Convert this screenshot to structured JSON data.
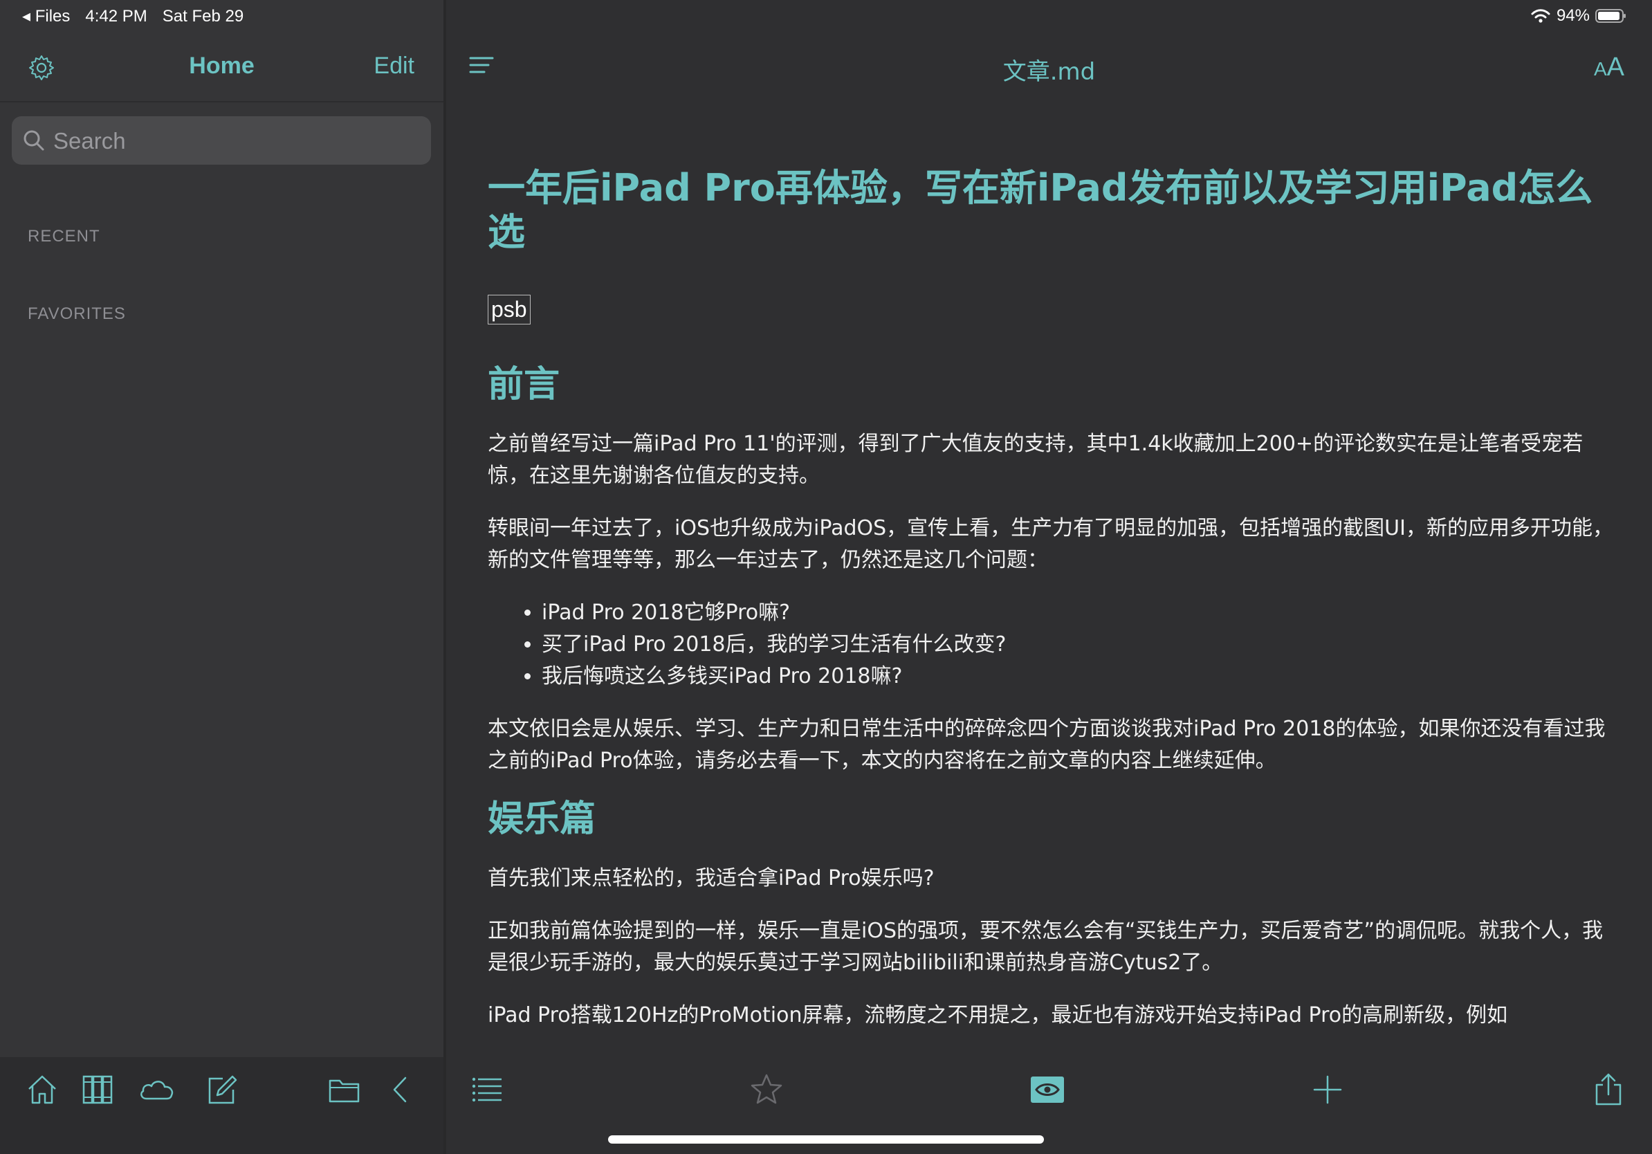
{
  "status_bar": {
    "back_app": "◂ Files",
    "time": "4:42 PM",
    "date": "Sat Feb 29",
    "battery": "94%",
    "battery_level": 0.94,
    "icons": [
      "wifi-icon",
      "battery-icon"
    ]
  },
  "sidebar": {
    "title": "Home",
    "edit_label": "Edit",
    "search_placeholder": "Search",
    "sections": [
      {
        "label": "RECENT"
      },
      {
        "label": "FAVORITES"
      }
    ],
    "toolbar_icons": [
      "home-icon",
      "library-icon",
      "cloud-icon",
      "compose-icon",
      "folder-icon",
      "collapse-chevron-icon"
    ]
  },
  "editor": {
    "doc_title": "文章.md",
    "font_button_small": "A",
    "font_button_big": "A",
    "toolbar_icons": [
      "outline-icon",
      "favorite-star-icon",
      "preview-eye-icon",
      "add-icon",
      "share-icon"
    ]
  },
  "article": {
    "h1": "一年后iPad Pro再体验，写在新iPad发布前以及学习用iPad怎么选",
    "image_alt": "psb",
    "section1_heading": "前言",
    "p1": "之前曾经写过一篇iPad Pro 11'的评测，得到了广大值友的支持，其中1.4k收藏加上200+的评论数实在是让笔者受宠若惊，在这里先谢谢各位值友的支持。",
    "p2": "转眼间一年过去了，iOS也升级成为iPadOS，宣传上看，生产力有了明显的加强，包括增强的截图UI，新的应用多开功能，新的文件管理等等，那么一年过去了，仍然还是这几个问题：",
    "list": [
      "iPad Pro 2018它够Pro嘛?",
      "买了iPad Pro 2018后，我的学习生活有什么改变?",
      "我后悔喷这么多钱买iPad Pro 2018嘛?"
    ],
    "p3": "本文依旧会是从娱乐、学习、生产力和日常生活中的碎碎念四个方面谈谈我对iPad Pro 2018的体验，如果你还没有看过我之前的iPad Pro体验，请务必去看一下，本文的内容将在之前文章的内容上继续延伸。",
    "section2_heading": "娱乐篇",
    "p4": "首先我们来点轻松的，我适合拿iPad Pro娱乐吗?",
    "p5": "正如我前篇体验提到的一样，娱乐一直是iOS的强项，要不然怎么会有“买钱生产力，买后爱奇艺”的调侃呢。就我个人，我是很少玩手游的，最大的娱乐莫过于学习网站bilibili和课前热身音游Cytus2了。",
    "p6": "iPad Pro搭载120Hz的ProMotion屏幕，流畅度之不用提之，最近也有游戏开始支持iPad Pro的高刷新级，例如"
  },
  "colors": {
    "accent": "#6cc3c3",
    "sidebar_bg": "#353537",
    "content_bg": "#2f2f31",
    "search_bg": "#4a4a4c"
  }
}
